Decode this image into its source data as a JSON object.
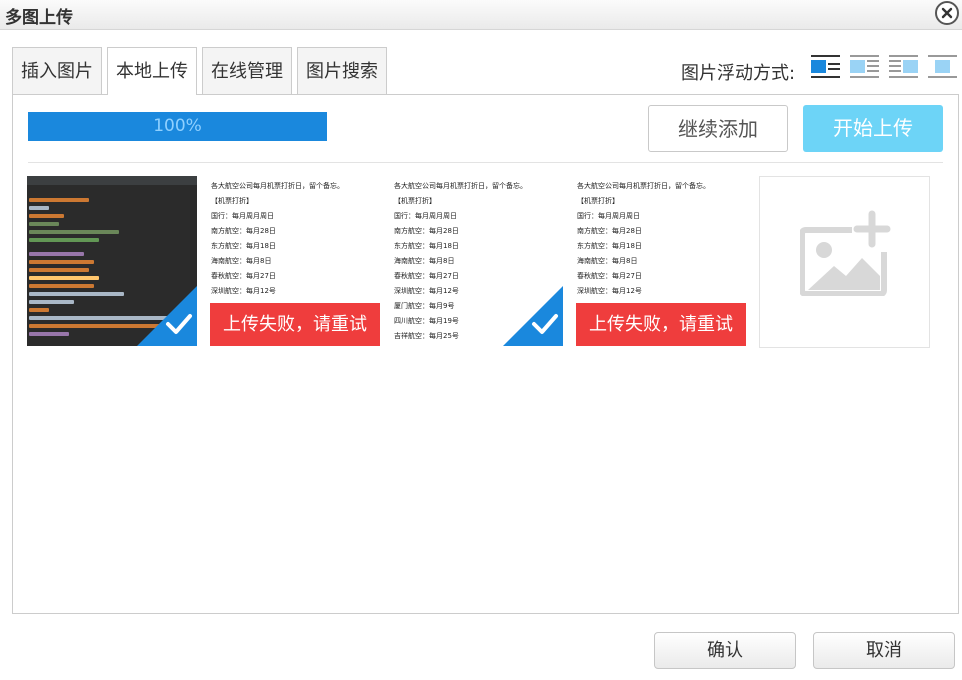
{
  "dialog": {
    "title": "多图上传"
  },
  "tabs": [
    {
      "label": "插入图片",
      "active": false
    },
    {
      "label": "本地上传",
      "active": true
    },
    {
      "label": "在线管理",
      "active": false
    },
    {
      "label": "图片搜索",
      "active": false
    }
  ],
  "float": {
    "label": "图片浮动方式:",
    "options": [
      "float-none-icon",
      "float-left-icon",
      "float-right-icon",
      "float-center-icon"
    ]
  },
  "upload": {
    "progress_percent": 100,
    "progress_label": "100%",
    "continue_label": "继续添加",
    "start_label": "开始上传"
  },
  "doc_text": {
    "lines_a": [
      "各大航空公司每月机票打折日，留个备忘。",
      "【机票打折】",
      "国行：每月周月周日",
      "南方航空：每月28日",
      "东方航空：每月18日",
      "海南航空：每月8日",
      "春秋航空：每月27日",
      "深圳航空：每月12号"
    ],
    "lines_b": [
      "各大航空公司每月机票打折日，留个备忘。",
      "【机票打折】",
      "国行：每月周月周日",
      "南方航空：每月28日",
      "东方航空：每月18日",
      "海南航空：每月8日",
      "春秋航空：每月27日",
      "深圳航空：每月12号",
      "厦门航空：每月9号",
      "四川航空：每月19号",
      "吉祥航空：每月25号"
    ]
  },
  "items": [
    {
      "type": "code",
      "status": "success"
    },
    {
      "type": "doc",
      "status": "failed",
      "message": "上传失败，请重试"
    },
    {
      "type": "doc",
      "status": "success"
    },
    {
      "type": "doc",
      "status": "failed",
      "message": "上传失败，请重试"
    }
  ],
  "footer": {
    "confirm_label": "确认",
    "cancel_label": "取消"
  },
  "colors": {
    "accent": "#1a88dd",
    "start_button": "#6dd4f7",
    "error": "#ef3d3d"
  }
}
